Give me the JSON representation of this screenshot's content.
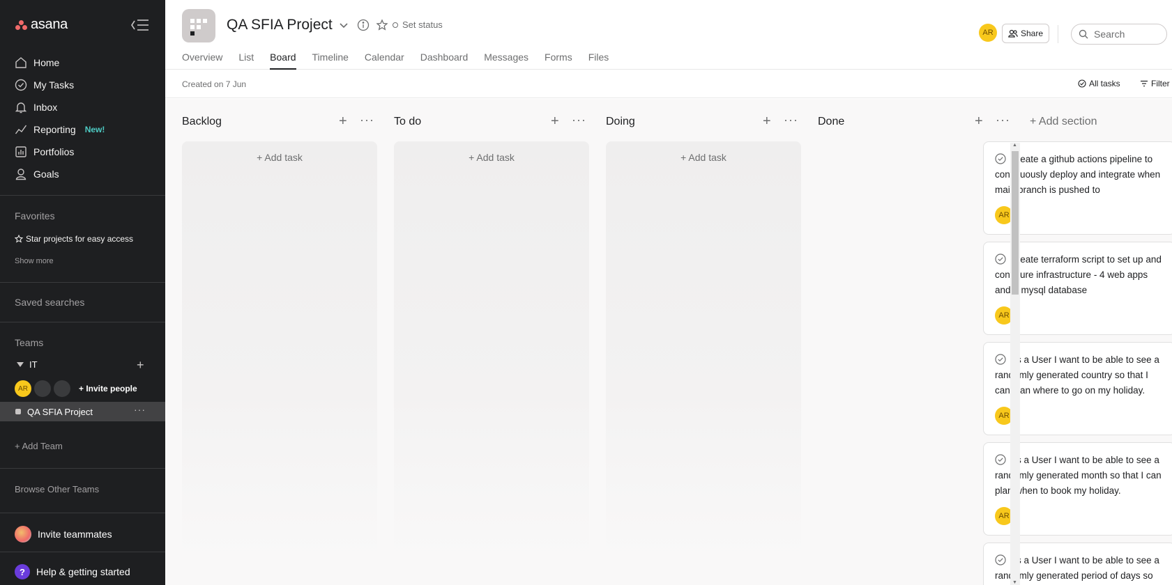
{
  "app": {
    "logo_text": "asana"
  },
  "sidebar": {
    "nav": [
      {
        "label": "Home",
        "icon": "home-icon"
      },
      {
        "label": "My Tasks",
        "icon": "check-circle-icon"
      },
      {
        "label": "Inbox",
        "icon": "bell-icon"
      },
      {
        "label": "Reporting",
        "icon": "chart-line-icon",
        "badge": "New!"
      },
      {
        "label": "Portfolios",
        "icon": "portfolio-icon"
      },
      {
        "label": "Goals",
        "icon": "person-goal-icon"
      }
    ],
    "favorites_title": "Favorites",
    "star_projects": "Star projects for easy access",
    "show_more": "Show more",
    "saved_searches": "Saved searches",
    "teams_title": "Teams",
    "team_name": "IT",
    "member_avatar": "AR",
    "invite_people": "Invite people",
    "project_name": "QA SFIA Project",
    "add_team": "Add Team",
    "browse_teams": "Browse Other Teams",
    "invite_teammates": "Invite teammates",
    "help": "Help & getting started",
    "help_glyph": "?"
  },
  "header": {
    "project_title": "QA SFIA Project",
    "set_status": "Set status",
    "tabs": [
      "Overview",
      "List",
      "Board",
      "Timeline",
      "Calendar",
      "Dashboard",
      "Messages",
      "Forms",
      "Files"
    ],
    "active_tab": "Board",
    "avatar": "AR",
    "share": "Share",
    "search_placeholder": "Search"
  },
  "subbar": {
    "created": "Created on 7 Jun",
    "all_tasks": "All tasks",
    "filter": "Filter"
  },
  "board": {
    "columns": [
      {
        "title": "Backlog",
        "add_task": "+ Add task"
      },
      {
        "title": "To do",
        "add_task": "+ Add task"
      },
      {
        "title": "Doing",
        "add_task": "+ Add task"
      },
      {
        "title": "Done"
      }
    ],
    "add_section": "+ Add section",
    "done_cards": [
      {
        "text": "Create a github actions pipeline to continuously deploy and integrate when main branch is pushed to",
        "assignee": "AR"
      },
      {
        "text": "Create terraform script to set up and configure infrastructure - 4 web apps and a mysql database",
        "assignee": "AR"
      },
      {
        "text": "As a User I want to be able to see a randomly generated country so that I can plan where to go on my holiday.",
        "assignee": "AR"
      },
      {
        "text": "As a User I want to be able to see a randomly generated month so that I can plan when to book my holiday.",
        "assignee": "AR"
      },
      {
        "text": "As a User I want to be able to see a randomly generated period of days so",
        "assignee": ""
      }
    ]
  },
  "colors": {
    "sidebar_bg": "#1e1f21",
    "avatar_yellow": "#f8c81c",
    "logo_coral": "#f06a6a",
    "new_badge": "#4ecbc4"
  }
}
